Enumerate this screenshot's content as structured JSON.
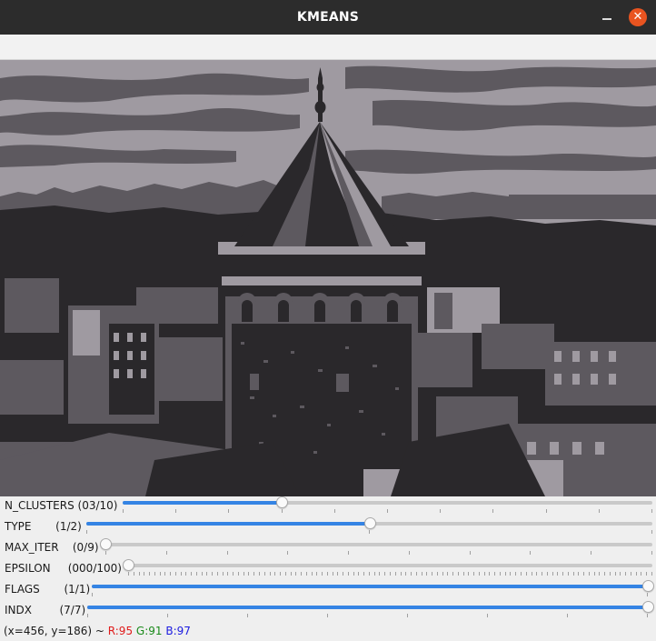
{
  "window": {
    "title": "KMEANS",
    "minimize_icon": "minimize-icon",
    "close_icon": "close-icon",
    "close_color": "#e95420"
  },
  "image": {
    "description_icon": "clustered-photo",
    "palette": [
      "#9f9aa1",
      "#5d595f",
      "#2a282b"
    ]
  },
  "trackbars": [
    {
      "name": "n-clusters",
      "label": "N_CLUSTERS (03/10)",
      "value": 3,
      "max": 10,
      "fraction": 0.3
    },
    {
      "name": "type",
      "label": "TYPE       (1/2)",
      "value": 1,
      "max": 2,
      "fraction": 0.5
    },
    {
      "name": "max-iter",
      "label": "MAX_ITER    (0/9)",
      "value": 0,
      "max": 9,
      "fraction": 0.0
    },
    {
      "name": "epsilon",
      "label": "EPSILON     (000/100)",
      "value": 0,
      "max": 100,
      "fraction": 0.0
    },
    {
      "name": "flags",
      "label": "FLAGS       (1/1)",
      "value": 1,
      "max": 1,
      "fraction": 1.0
    },
    {
      "name": "indx",
      "label": "INDX        (7/7)",
      "value": 7,
      "max": 7,
      "fraction": 1.0
    }
  ],
  "status": {
    "coords": "(x=456, y=186) ~ ",
    "r": "R:95",
    "g": "G:91",
    "b": "B:97"
  },
  "colors": {
    "accent": "#3584e4",
    "titlebar": "#2c2c2c"
  }
}
